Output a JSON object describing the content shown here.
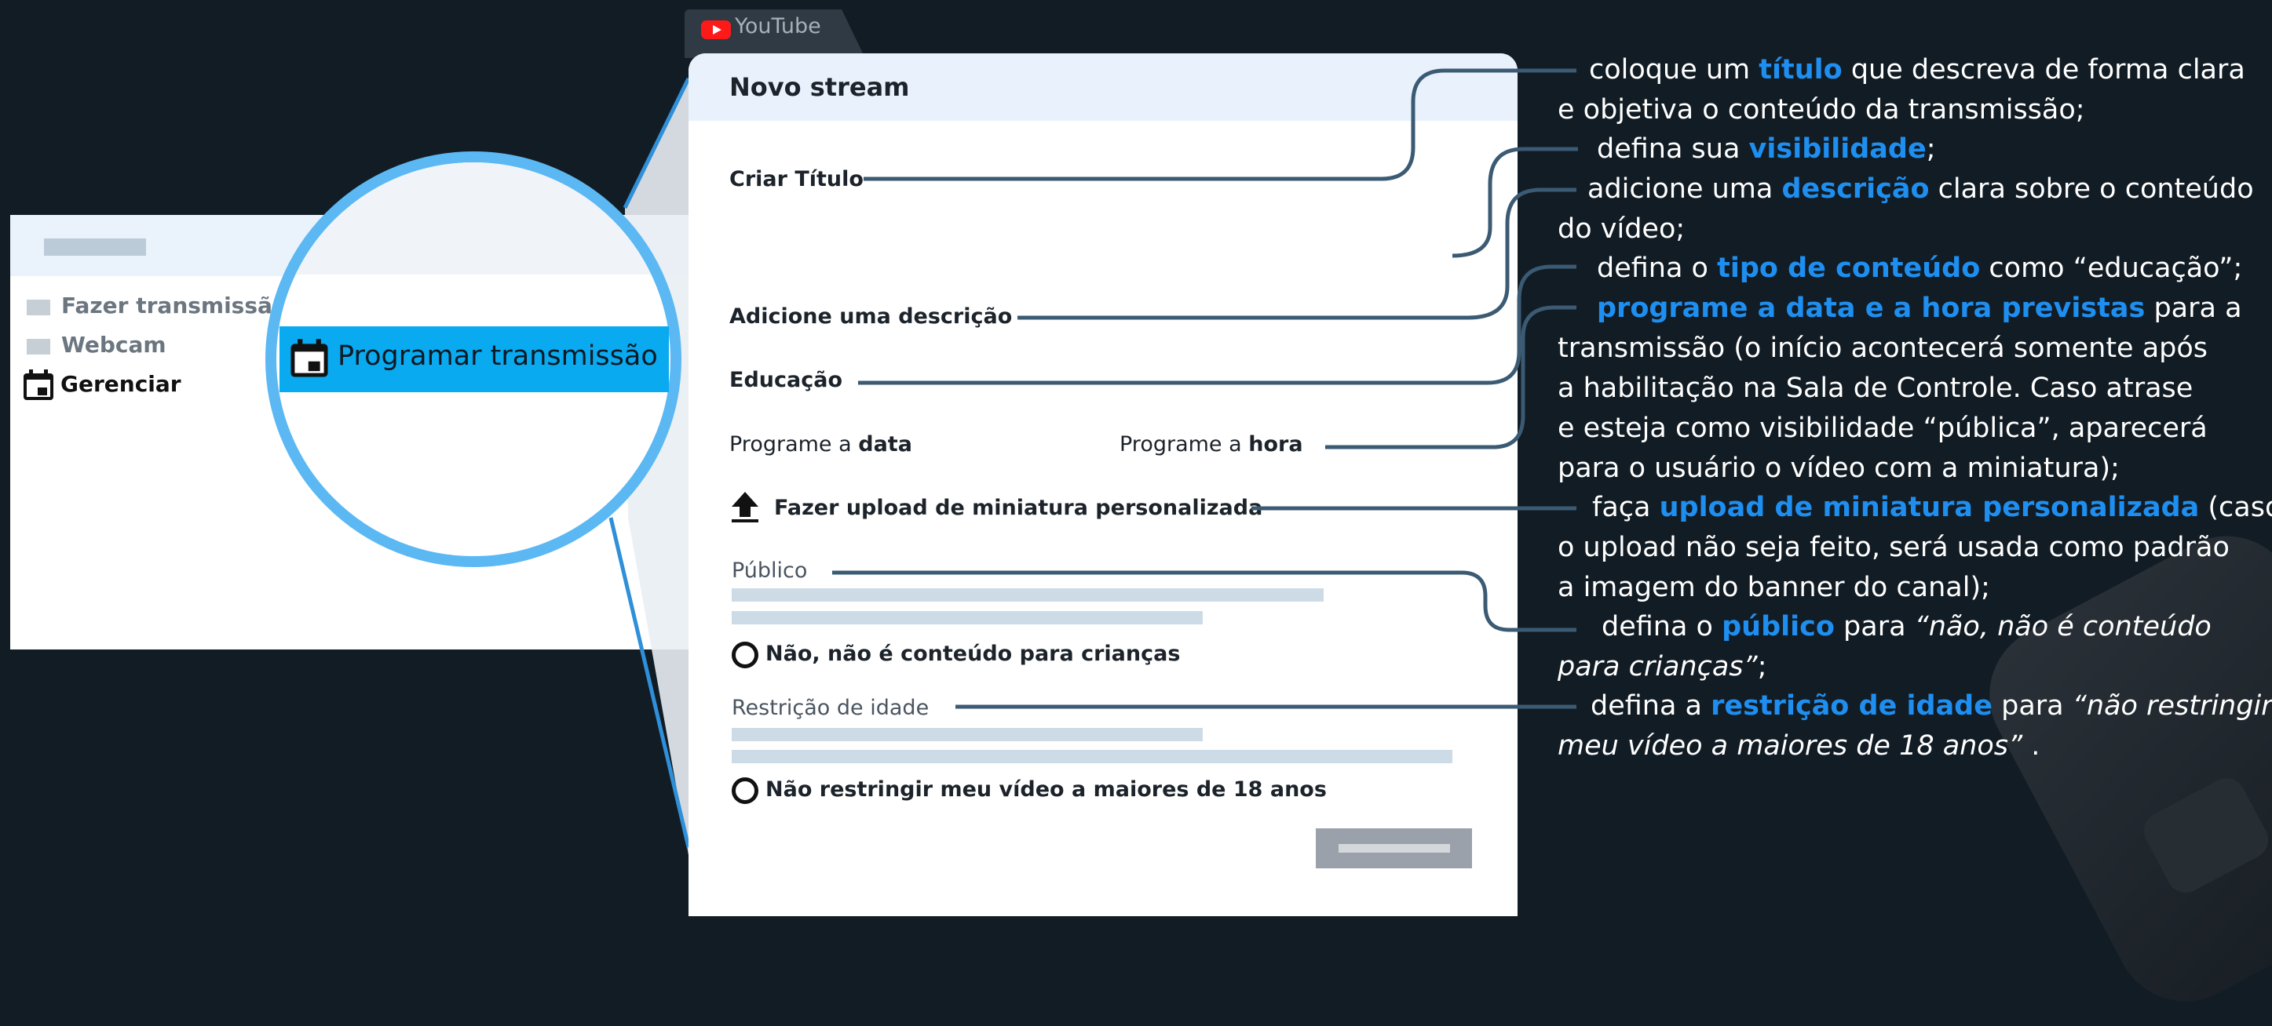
{
  "colors": {
    "background": "#121c24",
    "accent": "#1e8ff0",
    "button_blue": "#0aaaf0",
    "ring": "#5bb8f3"
  },
  "tab": {
    "icon": "youtube-icon",
    "label": "YouTube"
  },
  "left_menu": {
    "items": [
      {
        "label": "Fazer transmissão"
      },
      {
        "label": "Webcam"
      },
      {
        "label": "Gerenciar",
        "icon": "calendar-icon"
      }
    ],
    "magnified_button": {
      "label": "Programar transmissão",
      "icon": "calendar-icon"
    }
  },
  "form": {
    "title": "Novo stream",
    "criar_titulo": "Criar Título",
    "descricao": "Adicione uma descrição",
    "educacao": "Educação",
    "data_prefix": "Programe a ",
    "data_bold": "data",
    "hora_prefix": "Programe a ",
    "hora_bold": "hora",
    "upload": "Fazer upload de miniatura personalizada",
    "upload_icon": "upload-icon",
    "publico": "Público",
    "publico_option": "Não, não é conteúdo para crianças",
    "restricao": "Restrição de idade",
    "restricao_option": "Não restringir meu vídeo a maiores de 18 anos"
  },
  "instructions": {
    "i1_a": "coloque um ",
    "i1_hl": "título",
    "i1_b": " que descreva de forma clara",
    "i1_line2": "e objetiva o conteúdo da transmissão;",
    "i2_a": "defina sua ",
    "i2_hl": "visibilidade",
    "i2_b": ";",
    "i3_a": "adicione uma ",
    "i3_hl": "descrição",
    "i3_b": " clara sobre o conteúdo",
    "i3_line2": "do vídeo;",
    "i4_a": "defina o ",
    "i4_hl": "tipo de conteúdo",
    "i4_b": " como “educação”;",
    "i5_hl": "programe a data e a hora previstas",
    "i5_b": " para a",
    "i5_line2": "transmissão (o início acontecerá somente após",
    "i5_line3": "a habilitação na Sala de Controle. Caso atrase",
    "i5_line4": "e esteja como visibilidade “pública”, aparecerá",
    "i5_line5": "para o usuário o vídeo com a miniatura);",
    "i6_a": "faça ",
    "i6_hl": "upload de miniatura personalizada",
    "i6_b": " (caso",
    "i6_line2": "o upload não seja feito, será usada como padrão",
    "i6_line3": "a imagem do banner do canal);",
    "i7_a": "defina o ",
    "i7_hl": "público",
    "i7_b": " para ",
    "i7_it": "“não, não é conteúdo",
    "i7_line2_it": "para crianças”",
    "i7_line2_b": ";",
    "i8_a": "defina a ",
    "i8_hl": "restrição de idade",
    "i8_b": " para ",
    "i8_it": "“não restringir",
    "i8_line2_it": "meu vídeo a maiores de 18 anos”",
    "i8_line2_b": " ."
  }
}
